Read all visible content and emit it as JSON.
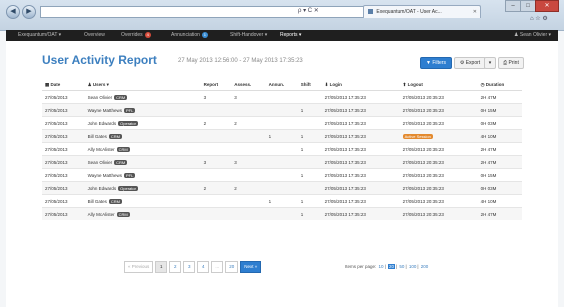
{
  "browser": {
    "address": "",
    "tab_title": "Exequantum/OAT - User Ac...",
    "addr_icons": "ρ ▾ C ✕"
  },
  "navbar": {
    "brand": "Exequantum/OAT ▾",
    "items": [
      {
        "label": "Overview"
      },
      {
        "label": "Overrides",
        "badge": "4"
      },
      {
        "label": "Annunciation",
        "badge": "1"
      },
      {
        "label": "Shift-Handover ▾"
      },
      {
        "label": "Reports ▾"
      }
    ],
    "user": "Sean Olivier ▾"
  },
  "page": {
    "title": "User Activity Report",
    "subtitle": "27 May 2013 12:56:00 - 27 May 2013 17:35:23",
    "buttons": {
      "filters": "Filters",
      "export": "Export",
      "print": "Print"
    }
  },
  "table": {
    "headers": [
      "Date",
      "Users",
      "Report",
      "Assess.",
      "Annun.",
      "Shift",
      "Login",
      "Logout",
      "Duration"
    ],
    "rows": [
      {
        "date": "27/05/2013",
        "user": "Sean Olivier",
        "role": "CRM",
        "report": "3",
        "assess": "3",
        "annun": "",
        "shift": "",
        "login": "27/05/2013 17:35:23",
        "logout": "27/05/2013 20:35:23",
        "duration": "2H 47M"
      },
      {
        "date": "27/05/2013",
        "user": "Wayne Matthews",
        "role": "PFL",
        "report": "",
        "assess": "",
        "annun": "",
        "shift": "1",
        "login": "27/05/2013 17:35:23",
        "logout": "27/05/2013 20:35:23",
        "duration": "0H 15M"
      },
      {
        "date": "27/05/2013",
        "user": "John Edwards",
        "role": "Operator",
        "report": "2",
        "assess": "2",
        "annun": "",
        "shift": "",
        "login": "27/05/2013 17:35:23",
        "logout": "27/05/2013 20:35:23",
        "duration": "0H 03M"
      },
      {
        "date": "27/05/2013",
        "user": "Bill Gates",
        "role": "CRM",
        "report": "",
        "assess": "",
        "annun": "1",
        "shift": "1",
        "login": "27/05/2013 17:35:23",
        "logout": "Active Session",
        "duration": "4H 10M"
      },
      {
        "date": "27/05/2013",
        "user": "Ally McAlister",
        "role": "CRM",
        "report": "",
        "assess": "",
        "annun": "",
        "shift": "1",
        "login": "27/05/2013 17:35:23",
        "logout": "27/05/2013 20:35:23",
        "duration": "2H 47M"
      },
      {
        "date": "27/05/2013",
        "user": "Sean Olivier",
        "role": "CRM",
        "report": "3",
        "assess": "3",
        "annun": "",
        "shift": "",
        "login": "27/05/2013 17:35:23",
        "logout": "27/05/2013 20:35:23",
        "duration": "2H 47M"
      },
      {
        "date": "27/05/2013",
        "user": "Wayne Matthews",
        "role": "PFL",
        "report": "",
        "assess": "",
        "annun": "",
        "shift": "1",
        "login": "27/05/2013 17:35:23",
        "logout": "27/05/2013 20:35:23",
        "duration": "0H 15M"
      },
      {
        "date": "27/05/2013",
        "user": "John Edwards",
        "role": "Operator",
        "report": "2",
        "assess": "2",
        "annun": "",
        "shift": "",
        "login": "27/05/2013 17:35:23",
        "logout": "27/05/2013 20:35:23",
        "duration": "0H 03M"
      },
      {
        "date": "27/05/2013",
        "user": "Bill Gates",
        "role": "CRM",
        "report": "",
        "assess": "",
        "annun": "1",
        "shift": "1",
        "login": "27/05/2013 17:35:23",
        "logout": "27/05/2013 20:35:23",
        "duration": "4H 10M"
      },
      {
        "date": "27/05/2013",
        "user": "Ally McAlister",
        "role": "CRM",
        "report": "",
        "assess": "",
        "annun": "",
        "shift": "1",
        "login": "27/05/2013 17:35:23",
        "logout": "27/05/2013 20:35:23",
        "duration": "2H 47M"
      }
    ]
  },
  "pagination": {
    "previous": "« Previous",
    "pages": [
      "1",
      "2",
      "3",
      "4",
      "...",
      "20"
    ],
    "current": "1",
    "next": "Next »",
    "per_page_label": "Items per page:",
    "per_page_options": [
      "10",
      "20",
      "50",
      "100",
      "200"
    ],
    "per_page_selected": "20"
  },
  "colors": {
    "accent": "#2e7ed0",
    "title": "#3c7fbf",
    "navbar": "#1f1f1f",
    "badge_red": "#d64b3a",
    "badge_blue": "#3b8ed4",
    "active_session": "#e38a2f"
  }
}
